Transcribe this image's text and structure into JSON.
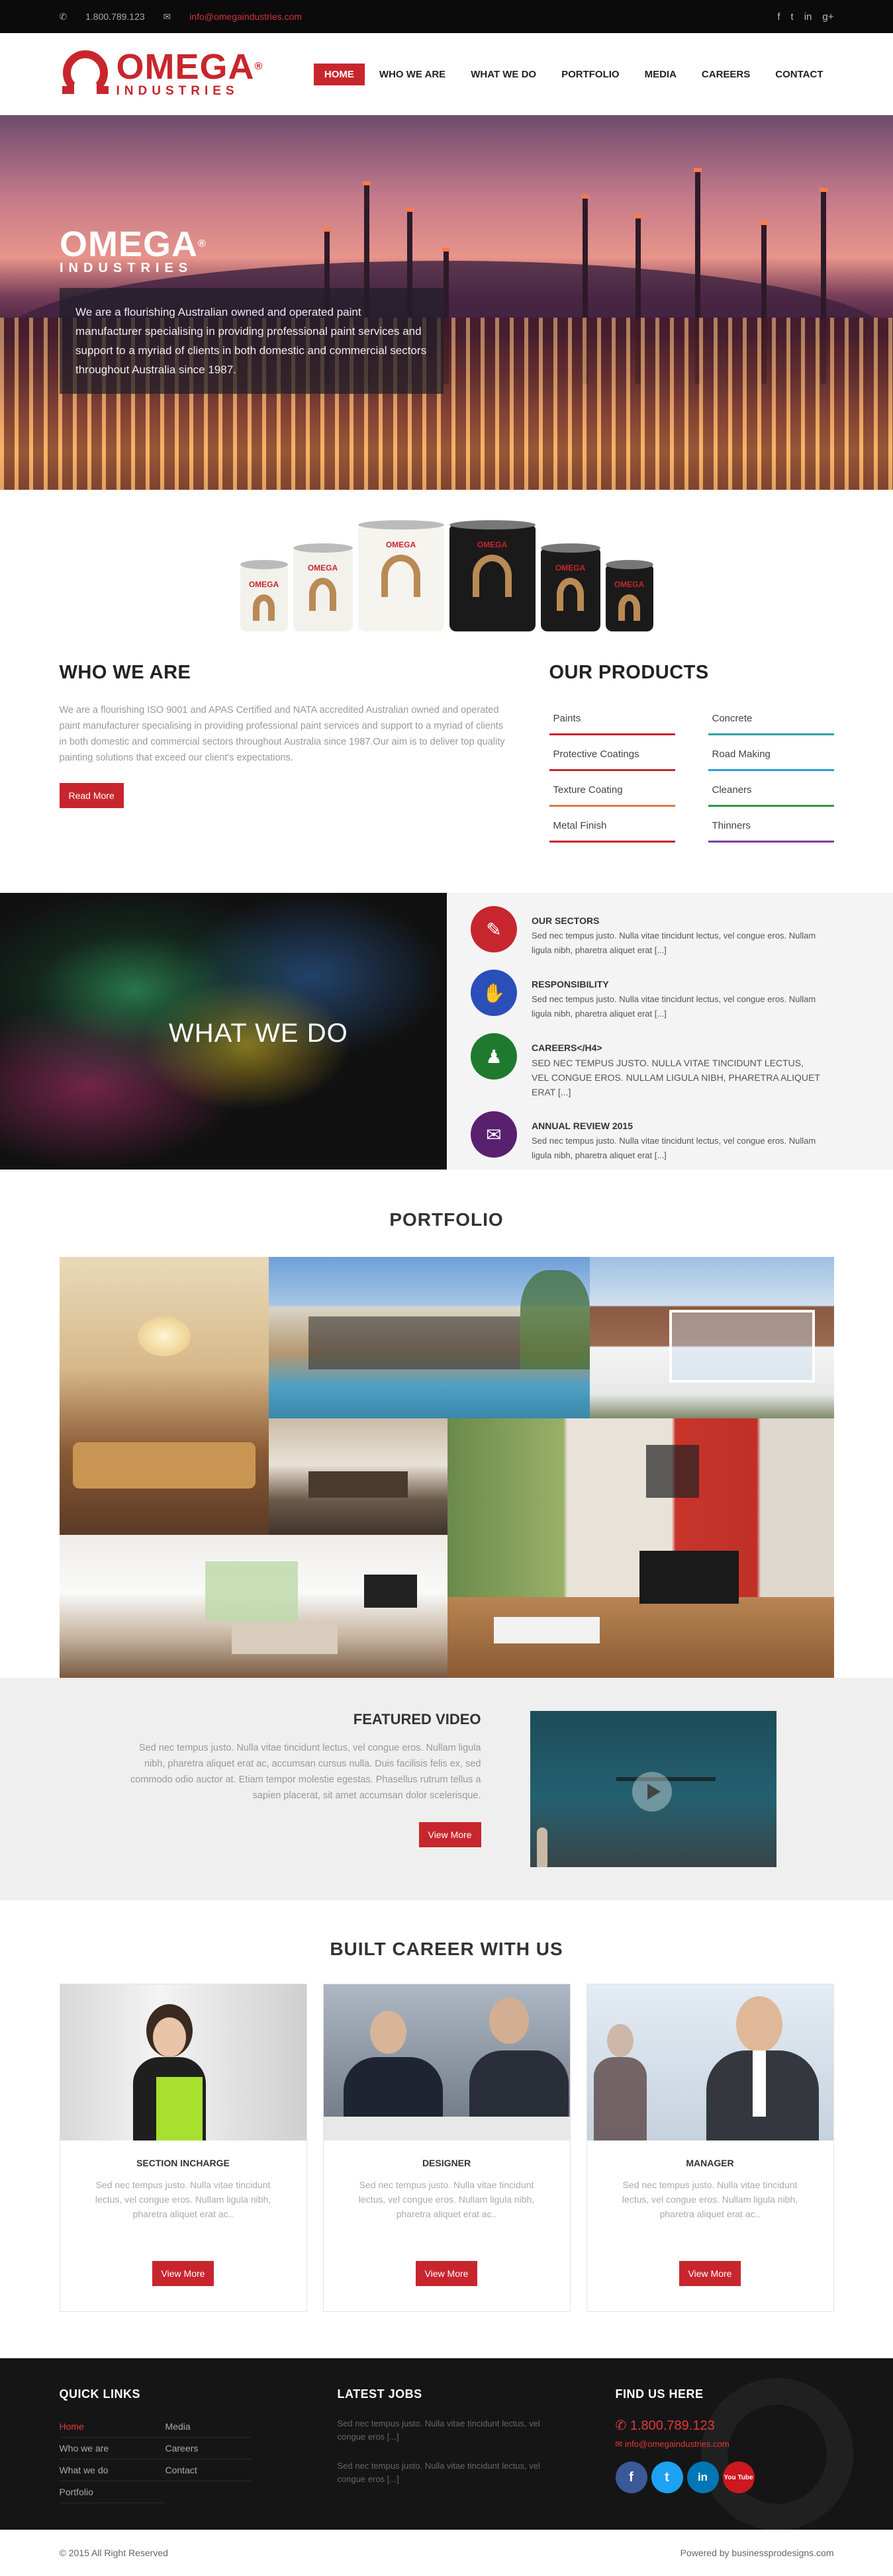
{
  "topbar": {
    "phone": "1.800.789.123",
    "email": "info@omegaindustries.com",
    "social_icons": [
      "facebook-icon",
      "twitter-icon",
      "linkedin-icon",
      "google-plus-icon"
    ]
  },
  "brand": {
    "name": "OMEGA",
    "sub": "INDUSTRIES",
    "reg": "®",
    "color": "#c8262e"
  },
  "nav": [
    {
      "label": "HOME",
      "active": true
    },
    {
      "label": "WHO WE ARE"
    },
    {
      "label": "WHAT WE DO"
    },
    {
      "label": "PORTFOLIO"
    },
    {
      "label": "MEDIA"
    },
    {
      "label": "CAREERS"
    },
    {
      "label": "CONTACT"
    }
  ],
  "hero": {
    "text": "We are a flourishing Australian owned and operated paint manufacturer specialising in providing professional paint services and support to a myriad of clients in both domestic and commercial sectors throughout Australia since 1987."
  },
  "paint_cans": {
    "label": "OMEGA"
  },
  "who": {
    "title": "WHO WE ARE",
    "text": "We are a flourishing ISO 9001 and APAS Certified and NATA accredited Australian owned and operated paint manufacturer specialising in providing professional paint services and support to a myriad of clients in both domestic and commercial sectors throughout Australia since 1987.Our aim is to deliver top quality painting solutions that exceed our client's expectations.",
    "button": "Read More"
  },
  "products": {
    "title": "OUR PRODUCTS",
    "items": [
      {
        "label": "Paints",
        "color": "#c8262e"
      },
      {
        "label": "Concrete",
        "color": "#2aa6a6"
      },
      {
        "label": "Protective Coatings",
        "color": "#c8262e"
      },
      {
        "label": "Road Making",
        "color": "#2a9fd6"
      },
      {
        "label": "Texture Coating",
        "color": "#e07a3a"
      },
      {
        "label": "Cleaners",
        "color": "#2a9a4a"
      },
      {
        "label": "Metal Finish",
        "color": "#c8262e"
      },
      {
        "label": "Thinners",
        "color": "#7a3fa0"
      }
    ]
  },
  "what_we_do": {
    "title": "WHAT WE DO",
    "items": [
      {
        "title": "OUR SECTORS",
        "text": "Sed nec tempus justo. Nulla vitae tincidunt lectus, vel congue eros. Nullam ligula nibh, pharetra aliquet erat [...]",
        "icon": "paint-brush-icon",
        "color": "#c8262e"
      },
      {
        "title": "RESPONSIBILITY",
        "text": "Sed nec tempus justo. Nulla vitae tincidunt lectus, vel congue eros. Nullam ligula nibh, pharetra aliquet erat [...]",
        "icon": "handshake-icon",
        "color": "#2a4fb8"
      },
      {
        "title": "CAREERS</H4>",
        "text": "Sed nec tempus justo. Nulla vitae tincidunt lectus, vel congue eros. Nullam ligula nibh, pharetra aliquet erat [...]",
        "icon": "person-icon",
        "color": "#1f7a2e"
      },
      {
        "title": "ANNUAL REVIEW 2015",
        "text": "Sed nec tempus justo. Nulla vitae tincidunt lectus, vel congue eros. Nullam ligula nibh, pharetra aliquet erat [...]",
        "icon": "chat-icon",
        "color": "#5a2070"
      }
    ]
  },
  "portfolio": {
    "title": "PORTFOLIO"
  },
  "featured": {
    "title": "FEATURED VIDEO",
    "text": "Sed nec tempus justo. Nulla vitae tincidunt lectus, vel congue eros. Nullam ligula nibh, pharetra aliquet erat ac, accumsan cursus nulla. Duis facilisis felis ex, sed commodo odio auctor at. Etiam tempor molestie egestas. Phasellus rutrum tellus a sapien placerat, sit amet accumsan dolor scelerisque.",
    "button": "View More"
  },
  "career": {
    "title": "BUILT CAREER WITH US",
    "cards": [
      {
        "role": "SECTION INCHARGE",
        "text": "Sed nec tempus justo. Nulla vitae tincidunt lectus, vel congue eros. Nullam ligula nibh, pharetra aliquet erat ac..",
        "button": "View More"
      },
      {
        "role": "DESIGNER",
        "text": "Sed nec tempus justo. Nulla vitae tincidunt lectus, vel congue eros. Nullam ligula nibh, pharetra aliquet erat ac..",
        "button": "View More"
      },
      {
        "role": "MANAGER",
        "text": "Sed nec tempus justo. Nulla vitae tincidunt lectus, vel congue eros. Nullam ligula nibh, pharetra aliquet erat ac..",
        "button": "View More"
      }
    ]
  },
  "footer": {
    "quick_links_title": "QUICK LINKS",
    "quick_links": [
      {
        "label": "Home",
        "active": true
      },
      {
        "label": "Media"
      },
      {
        "label": "Who we are"
      },
      {
        "label": "Careers"
      },
      {
        "label": "What we do"
      },
      {
        "label": "Contact"
      },
      {
        "label": "Portfolio"
      }
    ],
    "jobs_title": "LATEST JOBS",
    "jobs": [
      "Sed nec tempus justo. Nulla vitae tincidunt lectus, vel congue eros [...]",
      "Sed nec tempus justo. Nulla vitae tincidunt lectus, vel congue eros [...]"
    ],
    "find_title": "FIND US HERE",
    "phone": "1.800.789.123",
    "email": "info@omegaindustries.com",
    "social": [
      {
        "icon": "facebook-icon",
        "glyph": "f",
        "color": "#3b5998"
      },
      {
        "icon": "twitter-icon",
        "glyph": "t",
        "color": "#1da1f2"
      },
      {
        "icon": "linkedin-icon",
        "glyph": "in",
        "color": "#0077b5"
      },
      {
        "icon": "youtube-icon",
        "glyph": "You Tube",
        "color": "#cc181e"
      }
    ]
  },
  "copyright": {
    "left": "© 2015 All Right Reserved",
    "right": "Powered by businessprodesigns.com"
  }
}
